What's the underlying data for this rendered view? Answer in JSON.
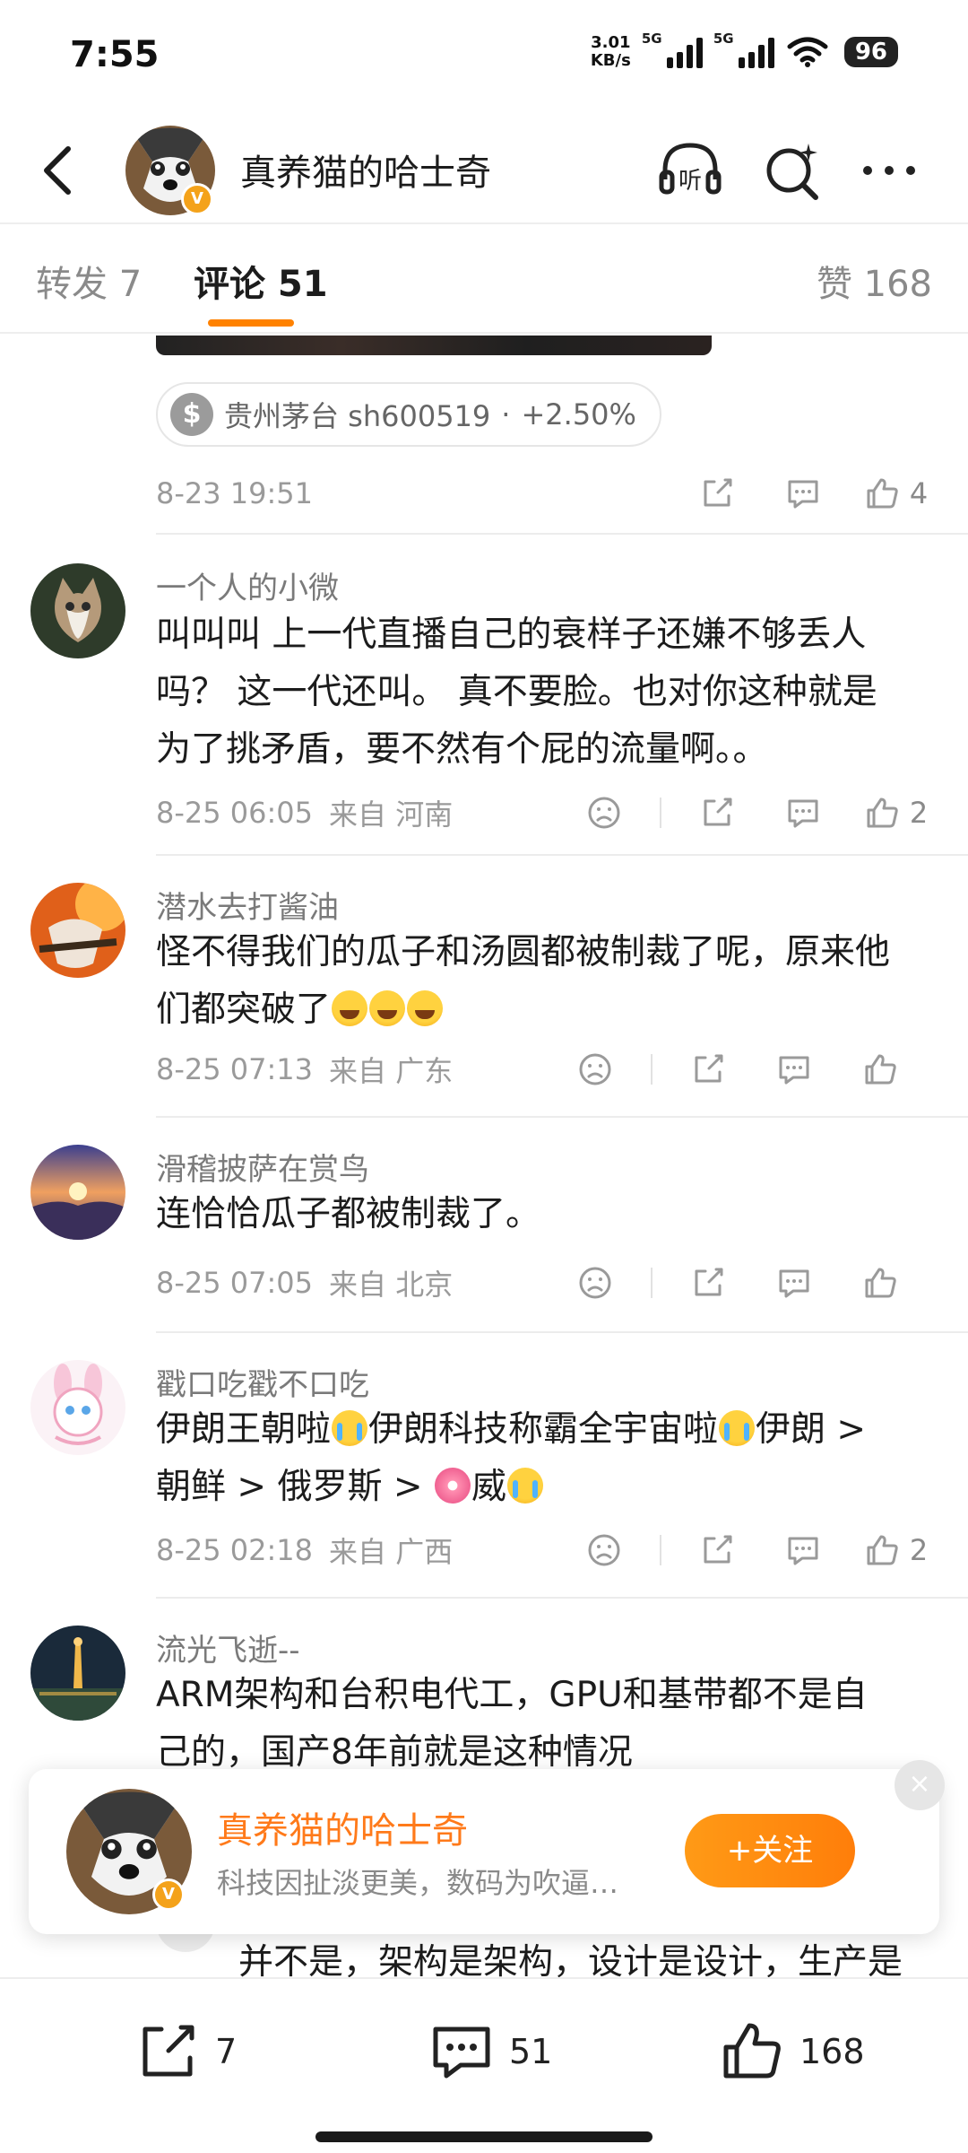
{
  "status_bar": {
    "time": "7:55",
    "net_speed_value": "3.01",
    "net_speed_unit": "KB/s",
    "sim1_label": "5G",
    "sim2_label": "5G",
    "battery": "96"
  },
  "header": {
    "title": "真养猫的哈士奇",
    "back_icon": "chevron-left-icon",
    "listen_label": "听",
    "icons": [
      "headphone-listen-icon",
      "search-sparkle-icon",
      "more-icon"
    ]
  },
  "tabs": {
    "repost": "转发 7",
    "comments": "评论 51",
    "likes": "赞 168"
  },
  "post_footer": {
    "stock_icon": "$",
    "stock_name": "贵州茅台 sh600519",
    "stock_sep": "·",
    "stock_change": "+2.50%",
    "time": "8-23 19:51",
    "like_count": "4"
  },
  "comments": [
    {
      "user": "一个人的小微",
      "lines": [
        "叫叫叫  上一代直播自己的衰样子还嫌不够丢人",
        "吗？ 这一代还叫。 真不要脸。也对你这种就是",
        "为了挑矛盾，要不然有个屁的流量啊。。"
      ],
      "time": "8-25 06:05",
      "location": "来自 河南",
      "like_count": "2"
    },
    {
      "user": "潜水去打酱油",
      "line1": "怪不得我们的瓜子和汤圆都被制裁了呢，原来他",
      "line2_text": "们都突破了",
      "time": "8-25 07:13",
      "location": "来自 广东",
      "like_count": ""
    },
    {
      "user": "滑稽披萨在赏鸟",
      "lines": [
        "连恰恰瓜子都被制裁了。"
      ],
      "time": "8-25 07:05",
      "location": "来自 北京",
      "like_count": ""
    },
    {
      "user": "戳口吃戳不口吃",
      "line1_a": "伊朗王朝啦",
      "line1_b": "伊朗科技称霸全宇宙啦",
      "line1_c": "伊朗 >",
      "line2_a": "朝鲜 > 俄罗斯 > ",
      "line2_b": "威",
      "time": "8-25 02:18",
      "location": "来自 广西",
      "like_count": "2"
    },
    {
      "user": "流光飞逝--",
      "lines": [
        "ARM架构和台积电代工，GPU和基带都不是自",
        "己的，国产8年前就是这种情况"
      ],
      "time": "",
      "location": "",
      "like_count": ""
    }
  ],
  "reply_preview": "并不是，架构是架构，设计是设计，生产是",
  "follow_card": {
    "name": "真养猫的哈士奇",
    "desc": "科技因扯淡更美，数码为吹逼…",
    "button": "+关注",
    "close": "×"
  },
  "bottom_bar": {
    "repost_count": "7",
    "comment_count": "51",
    "like_count": "168"
  },
  "colors": {
    "accent": "#ff8200",
    "meta_gray": "#9a9a9a",
    "verified": "#f4a21a"
  }
}
